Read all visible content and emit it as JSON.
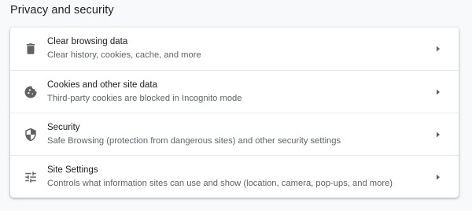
{
  "section": {
    "title": "Privacy and security"
  },
  "items": [
    {
      "icon": "trash-icon",
      "label": "Clear browsing data",
      "sublabel": "Clear history, cookies, cache, and more"
    },
    {
      "icon": "cookie-icon",
      "label": "Cookies and other site data",
      "sublabel": "Third-party cookies are blocked in Incognito mode"
    },
    {
      "icon": "shield-icon",
      "label": "Security",
      "sublabel": "Safe Browsing (protection from dangerous sites) and other security settings"
    },
    {
      "icon": "tune-icon",
      "label": "Site Settings",
      "sublabel": "Controls what information sites can use and show (location, camera, pop-ups, and more)"
    }
  ],
  "colors": {
    "page_background": "#f8f9fa",
    "card_background": "#ffffff",
    "icon": "#5f6368",
    "text_primary": "#202124",
    "text_secondary": "#5f6368",
    "divider": "#e8eaed"
  }
}
